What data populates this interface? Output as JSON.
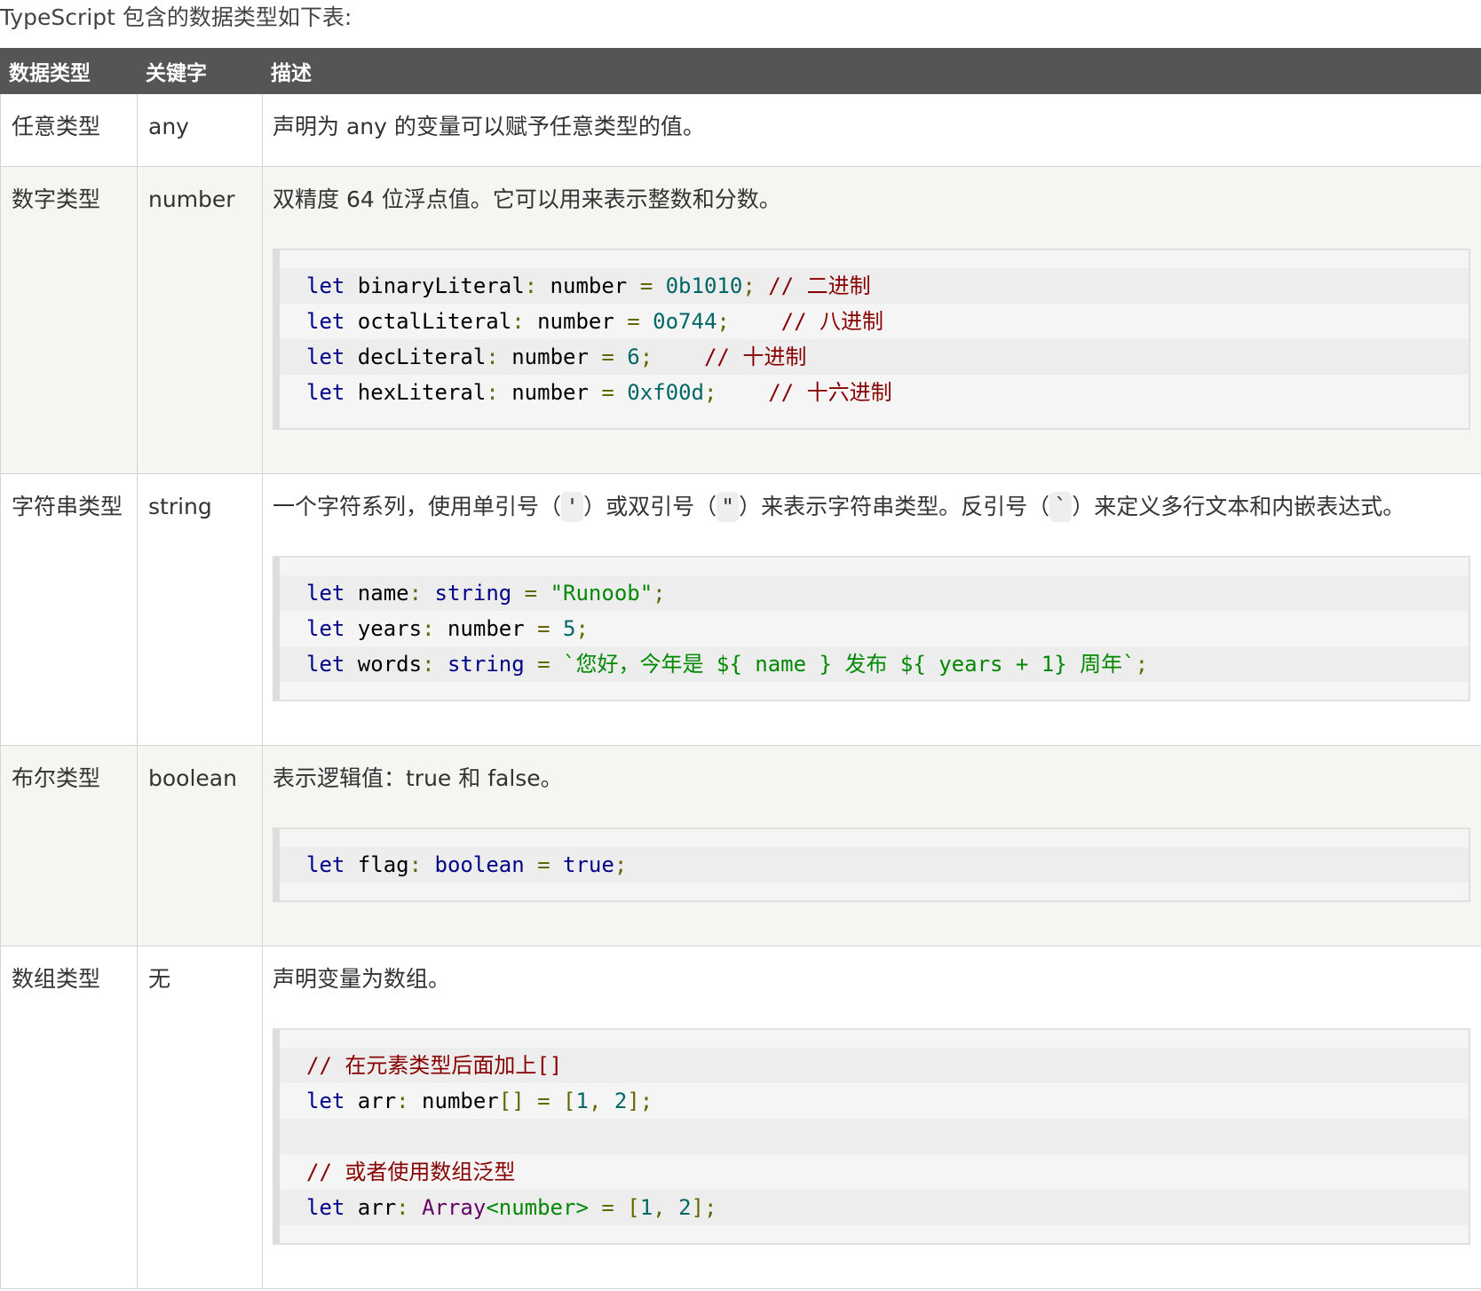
{
  "intro": "TypeScript 包含的数据类型如下表:",
  "table": {
    "headers": [
      "数据类型",
      "关键字",
      "描述"
    ],
    "rows": [
      {
        "type": "任意类型",
        "keyword": "any",
        "description": "声明为 any 的变量可以赋予任意类型的值。"
      },
      {
        "type": "数字类型",
        "keyword": "number",
        "description": "双精度 64 位浮点值。它可以用来表示整数和分数。",
        "code": [
          "let binaryLiteral: number = 0b1010; // 二进制",
          "let octalLiteral: number = 0o744;    // 八进制",
          "let decLiteral: number = 6;    // 十进制",
          "let hexLiteral: number = 0xf00d;    // 十六进制"
        ]
      },
      {
        "type": "字符串类型",
        "keyword": "string",
        "description_parts": [
          "一个字符系列，使用单引号（",
          "'",
          "）或双引号（",
          "\"",
          "）来表示字符串类型。反引号（",
          "`",
          "）来定义多行文本和内嵌表达式。"
        ],
        "code": [
          "let name: string = \"Runoob\";",
          "let years: number = 5;",
          "let words: string = `您好，今年是 ${ name } 发布 ${ years + 1} 周年`;"
        ]
      },
      {
        "type": "布尔类型",
        "keyword": "boolean",
        "description": "表示逻辑值：true 和 false。",
        "code": [
          "let flag: boolean = true;"
        ]
      },
      {
        "type": "数组类型",
        "keyword": "无",
        "description": "声明变量为数组。",
        "code": [
          "// 在元素类型后面加上[]",
          "let arr: number[] = [1, 2];",
          "",
          "// 或者使用数组泛型",
          "let arr: Array<number> = [1, 2];"
        ]
      }
    ]
  }
}
